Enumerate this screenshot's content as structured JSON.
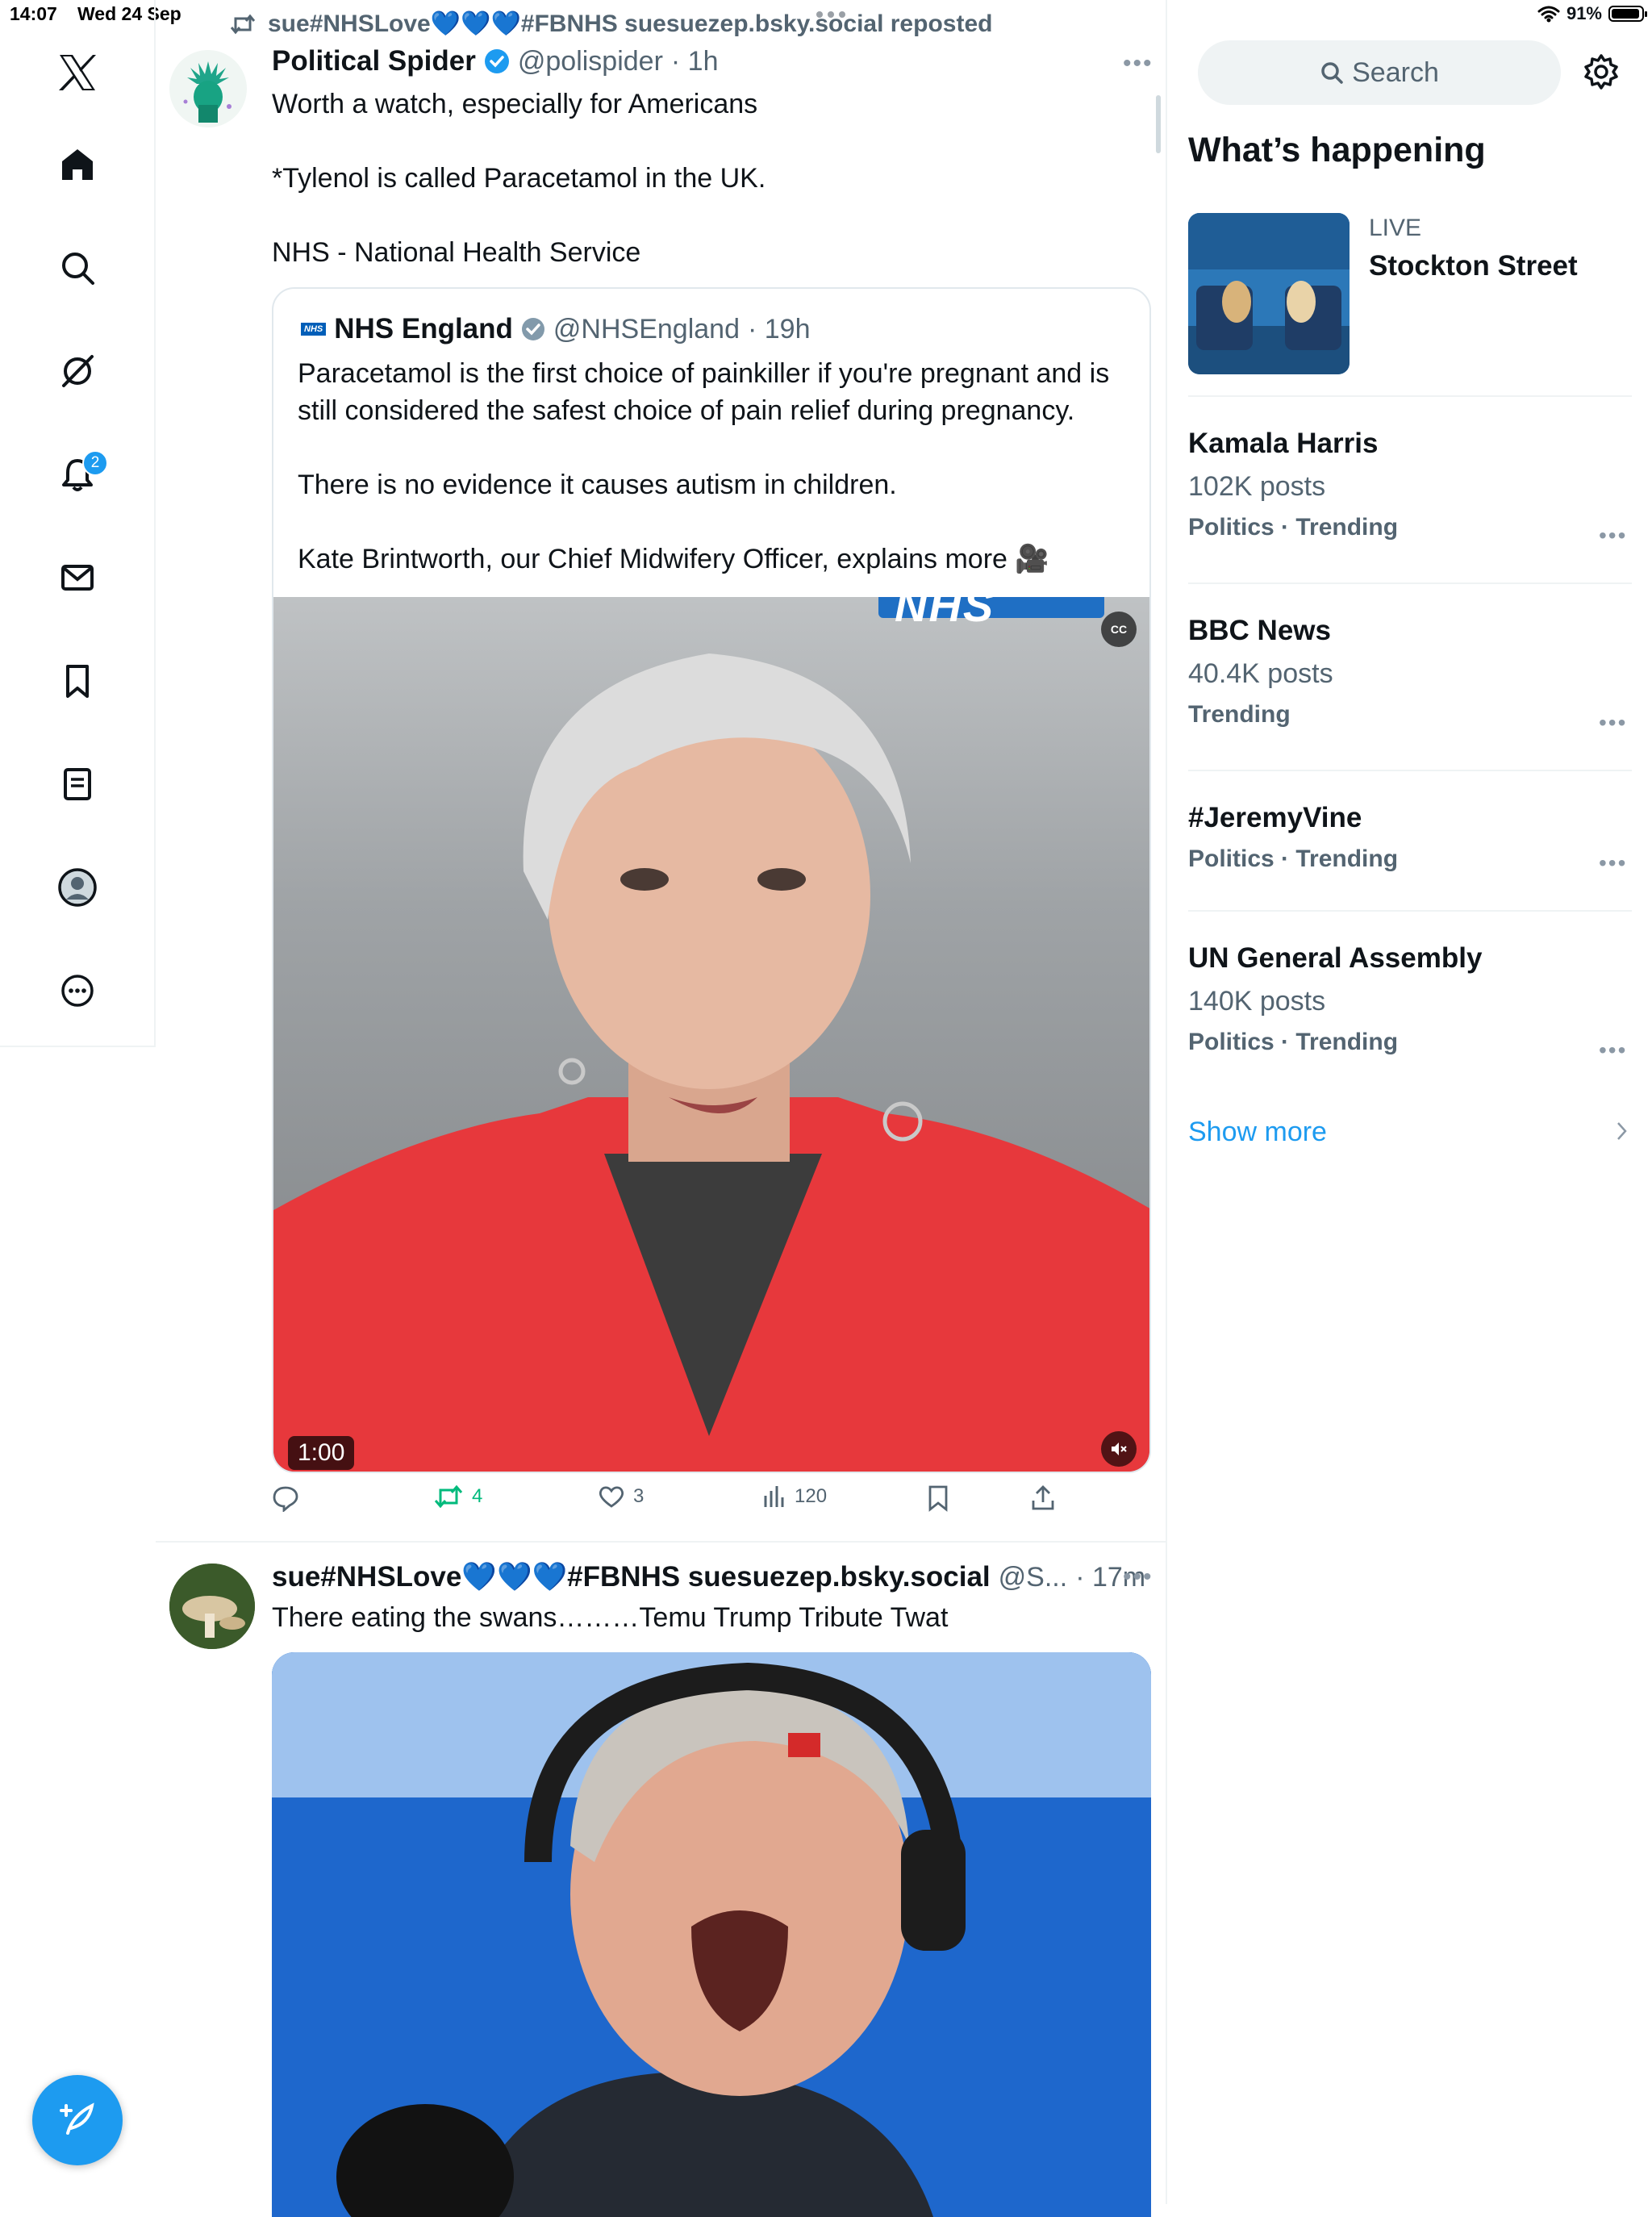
{
  "status_bar": {
    "time": "14:07",
    "date": "Wed 24 Sep",
    "battery": "91%"
  },
  "nav": {
    "notifications_badge": "2",
    "items": [
      "x-logo-icon",
      "home-icon",
      "search-icon",
      "grok-icon",
      "bell-icon",
      "mail-icon",
      "bookmark-icon",
      "lists-icon",
      "profile-icon",
      "more-icon"
    ]
  },
  "feed": {
    "post1": {
      "repost_label": "sue#NHSLove💙💙💙#FBNHS suesuezep.bsky.social reposted",
      "author_name": "Political Spider",
      "handle": "@polispider",
      "time": "· 1h",
      "text": "Worth a watch, especially for Americans\n\n*Tylenol is called Paracetamol in the UK.\n\nNHS - National Health Service",
      "quote": {
        "logo_text": "NHS",
        "author_name": "NHS England",
        "handle": "@NHSEngland",
        "time": "· 19h",
        "text": "Paracetamol is the first choice of painkiller if you're pregnant and is still considered the safest choice of pain relief during pregnancy.\n\nThere is no evidence it causes autism in children.\n\nKate Brintworth, our Chief Midwifery Officer, explains more 🎥",
        "video_duration": "1:00",
        "video_overlay_text": "NHS"
      },
      "actions": {
        "replies": "",
        "reposts": "4",
        "likes": "3",
        "views": "120"
      }
    },
    "post2": {
      "author_name": "sue#NHSLove💙💙💙#FBNHS suesuezep.bsky.social",
      "handle": "@S...",
      "time": "· 17m",
      "text": "There eating the swans………Temu Trump Tribute Twat"
    }
  },
  "sidebar": {
    "search_placeholder": "Search",
    "section_title": "What’s happening",
    "live": {
      "label": "LIVE",
      "title": "Stockton Street"
    },
    "trends": [
      {
        "title": "Kamala Harris",
        "posts": "102K posts",
        "category": "Politics · Trending"
      },
      {
        "title": "BBC News",
        "posts": "40.4K posts",
        "category": "Trending"
      },
      {
        "title": "#JeremyVine",
        "posts": "",
        "category": "Politics · Trending"
      },
      {
        "title": "UN General Assembly",
        "posts": "140K posts",
        "category": "Politics · Trending"
      }
    ],
    "show_more": "Show more"
  },
  "colors": {
    "accent": "#1d9bf0",
    "repost_green": "#00ba7c",
    "text_secondary": "#536471",
    "divider": "#eff3f4"
  }
}
